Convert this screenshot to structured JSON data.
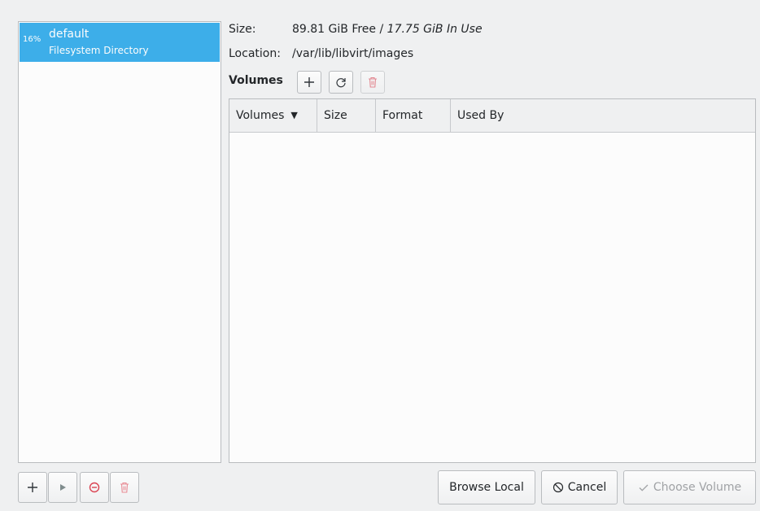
{
  "pool": {
    "percent": "16%",
    "name": "default",
    "type": "Filesystem Directory"
  },
  "info": {
    "size_label": "Size:",
    "size_free": "89.81 GiB Free / ",
    "size_used": "17.75 GiB In Use",
    "location_label": "Location:",
    "location_value": "/var/lib/libvirt/images"
  },
  "volumes": {
    "title": "Volumes",
    "columns": [
      "Volumes",
      "Size",
      "Format",
      "Used By"
    ]
  },
  "buttons": {
    "browse_local": "Browse Local",
    "cancel": "Cancel",
    "choose_volume": "Choose Volume"
  },
  "icons": {
    "add": "plus-icon",
    "refresh": "refresh-icon",
    "delete": "trash-icon",
    "start": "play-icon",
    "stop": "stop-icon",
    "cancel": "cancel-circle-icon",
    "check": "check-icon"
  },
  "colors": {
    "accent": "#3daee9",
    "danger": "#da4453"
  }
}
